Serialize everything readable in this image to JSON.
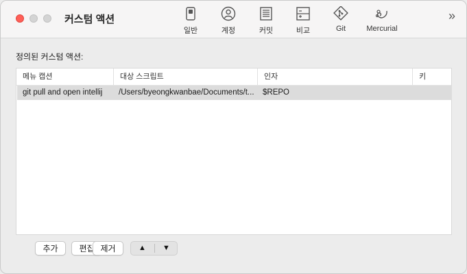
{
  "window": {
    "title": "커스텀 액션"
  },
  "toolbar": {
    "items": [
      {
        "label": "일반",
        "icon": "general-icon"
      },
      {
        "label": "계정",
        "icon": "account-icon"
      },
      {
        "label": "커밋",
        "icon": "commit-icon"
      },
      {
        "label": "비교",
        "icon": "diff-icon"
      },
      {
        "label": "Git",
        "icon": "git-icon"
      },
      {
        "label": "Mercurial",
        "icon": "mercurial-icon"
      }
    ],
    "more": "»"
  },
  "main": {
    "section_label": "정의된 커스텀 액션:",
    "table": {
      "columns": [
        "메뉴 캡션",
        "대상 스크립트",
        "인자",
        "키"
      ],
      "rows": [
        [
          "git pull and open intellij",
          "/Users/byeongkwanbae/Documents/t...",
          "$REPO",
          ""
        ]
      ]
    },
    "buttons": {
      "add": "추가",
      "edit": "편집",
      "remove": "제거",
      "up": "▲",
      "down": "▼"
    }
  },
  "colors": {
    "close": "#ff5f57",
    "selection": "#dcdcdc",
    "background": "#ececec"
  }
}
